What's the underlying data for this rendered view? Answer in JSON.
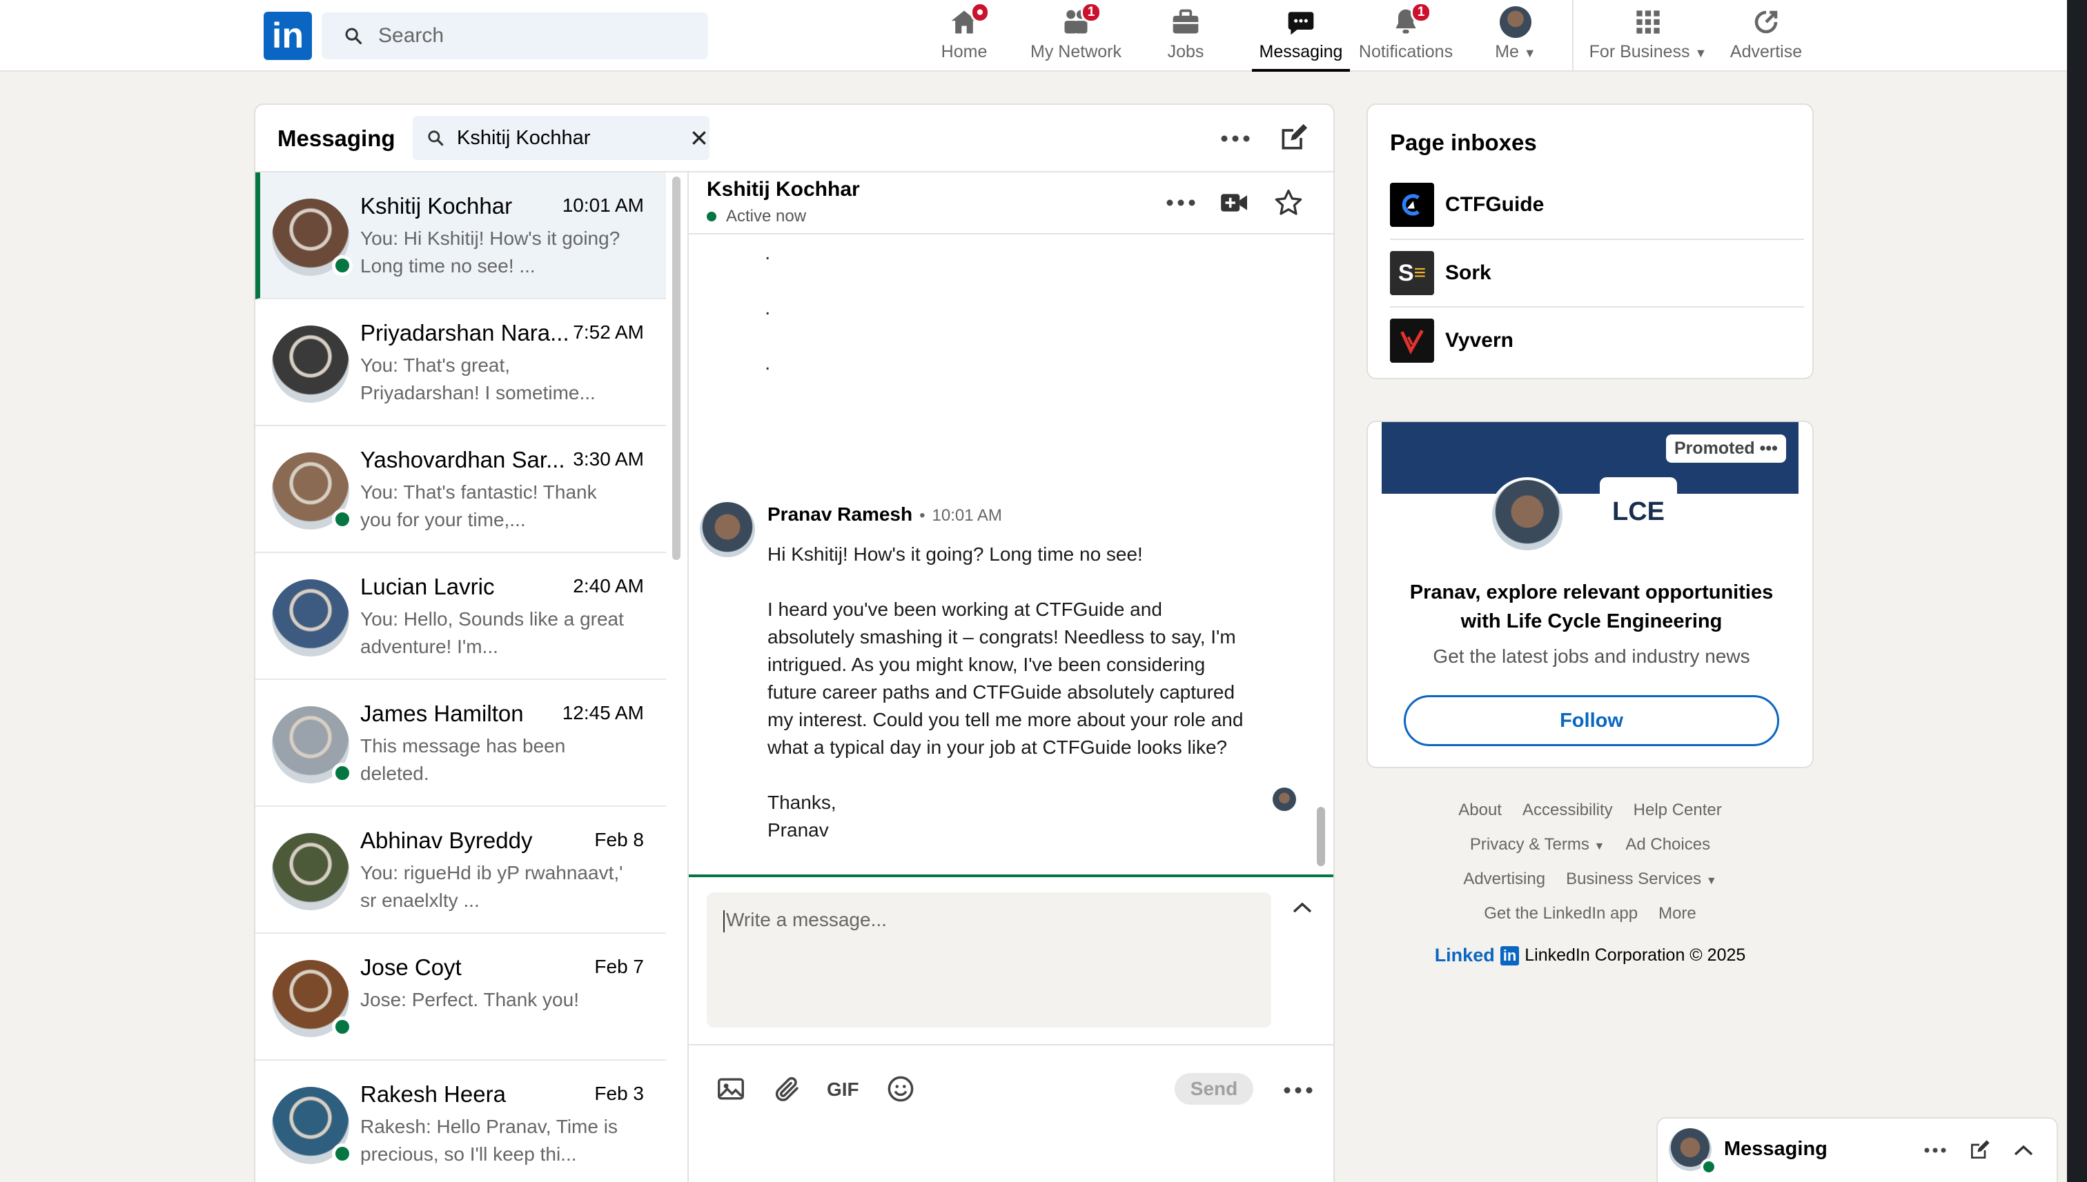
{
  "search": {
    "placeholder": "Search"
  },
  "nav": {
    "home": {
      "label": "Home"
    },
    "network": {
      "label": "My Network",
      "badge": "1"
    },
    "jobs": {
      "label": "Jobs"
    },
    "messaging": {
      "label": "Messaging"
    },
    "notifications": {
      "label": "Notifications",
      "badge": "1"
    },
    "me": {
      "label": "Me"
    },
    "business": {
      "label": "For Business"
    },
    "advertise": {
      "label": "Advertise"
    }
  },
  "messaging": {
    "title": "Messaging",
    "filter_value": "Kshitij Kochhar"
  },
  "conversations": [
    {
      "name": "Kshitij Kochhar",
      "time": "10:01 AM",
      "preview": "You: Hi Kshitij! How's it going? Long time no see! ...",
      "online": true,
      "selected": true,
      "color": "#6b4a3a"
    },
    {
      "name": "Priyadarshan Nara...",
      "time": "7:52 AM",
      "preview": "You: That's great, Priyadarshan! I sometime...",
      "online": false,
      "color": "#3a3a3a"
    },
    {
      "name": "Yashovardhan Sar...",
      "time": "3:30 AM",
      "preview": "You: That's fantastic! Thank you for your time,...",
      "online": true,
      "color": "#8a6a52"
    },
    {
      "name": "Lucian Lavric",
      "time": "2:40 AM",
      "preview": "You: Hello,  Sounds like a great adventure! I'm...",
      "online": false,
      "color": "#3d5a80"
    },
    {
      "name": "James Hamilton",
      "time": "12:45 AM",
      "preview": "This message has been deleted.",
      "online": true,
      "color": "#9aa3ab"
    },
    {
      "name": "Abhinav Byreddy",
      "time": "Feb 8",
      "preview": "You: rigueHd ib yP rwahnaavt,' sr enaelxlty ...",
      "online": false,
      "color": "#4d5a3a"
    },
    {
      "name": "Jose Coyt",
      "time": "Feb 7",
      "preview": "Jose: Perfect. Thank you!",
      "online": true,
      "color": "#7a4a2a"
    },
    {
      "name": "Rakesh Heera",
      "time": "Feb 3",
      "preview": "Rakesh: Hello Pranav, Time is precious, so I'll keep thi...",
      "online": true,
      "color": "#2f5f7f"
    }
  ],
  "thread": {
    "name": "Kshitij Kochhar",
    "status": "Active now",
    "dots": [
      ".",
      ".",
      "."
    ],
    "sender": "Pranav Ramesh",
    "time": "10:01 AM",
    "body": "Hi Kshitij! How's it going? Long time no see!\n\nI heard you've been working at CTFGuide and absolutely smashing it – congrats! Needless to say, I'm intrigued. As you might know, I've been considering future career paths and CTFGuide absolutely captured my interest. Could you tell me more about your role and what a typical day in your job at CTFGuide looks like?\n\nThanks,\nPranav",
    "compose_placeholder": "Write a message...",
    "gif_label": "GIF",
    "send_label": "Send"
  },
  "inboxes": {
    "title": "Page inboxes",
    "items": [
      {
        "name": "CTFGuide",
        "color": "#000000"
      },
      {
        "name": "Sork",
        "color": "#2b2b2b"
      },
      {
        "name": "Vyvern",
        "color": "#111111"
      }
    ]
  },
  "promo": {
    "badge": "Promoted",
    "logo_text": "LCE",
    "headline": "Pranav, explore relevant opportunities with Life Cycle Engineering",
    "sub": "Get the latest jobs and industry news",
    "follow": "Follow"
  },
  "footer": {
    "about": "About",
    "accessibility": "Accessibility",
    "help": "Help Center",
    "privacy": "Privacy & Terms",
    "adchoices": "Ad Choices",
    "advertising": "Advertising",
    "business": "Business Services",
    "app": "Get the LinkedIn app",
    "more": "More",
    "brand": "Linked",
    "brand_box": "in",
    "copyright": "LinkedIn Corporation © 2025"
  },
  "mini": {
    "title": "Messaging"
  },
  "colors": {
    "accent": "#0a66c2",
    "online": "#057642",
    "badge": "#cb112d"
  }
}
